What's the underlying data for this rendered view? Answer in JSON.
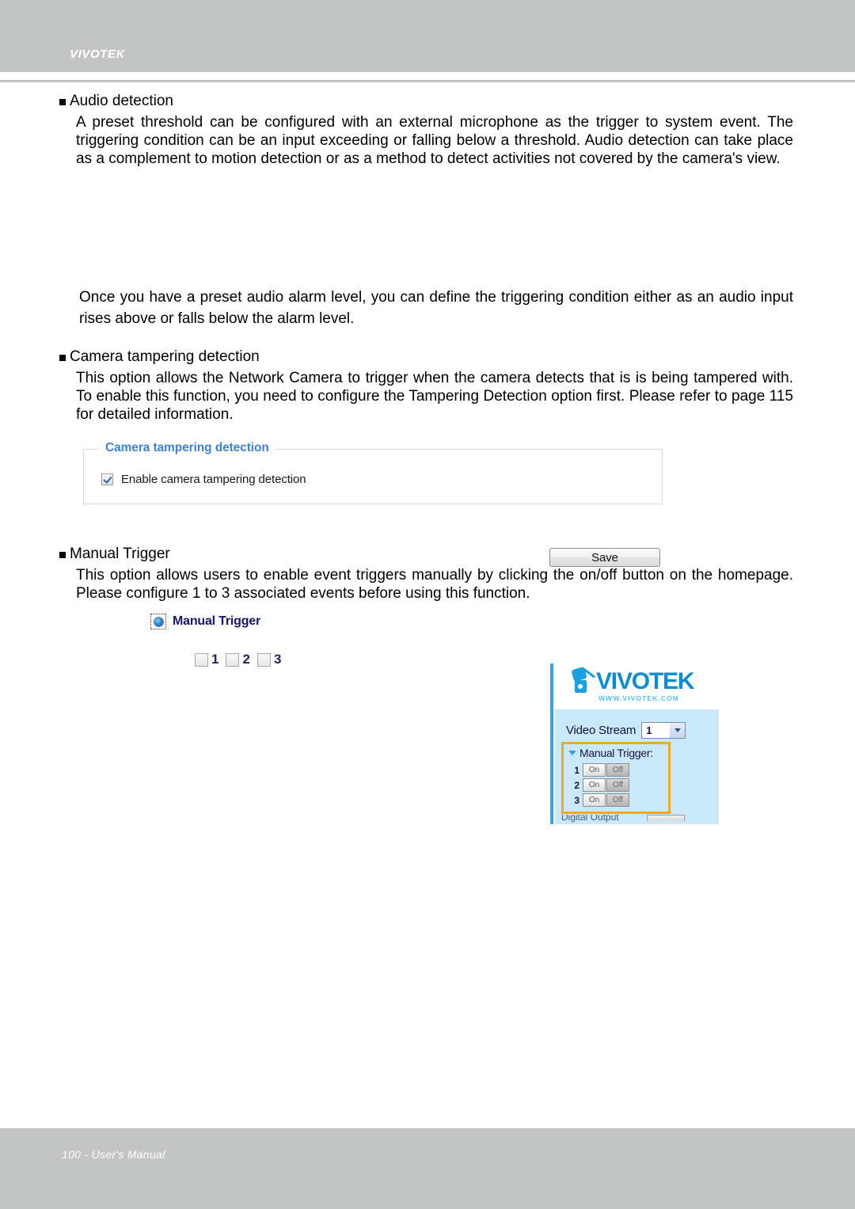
{
  "header": {
    "brand": "VIVOTEK"
  },
  "sections": {
    "audio_detection": {
      "heading": "Audio detection",
      "body": "A preset threshold can be configured with an external microphone as the trigger to system event. The triggering condition can be an input exceeding or falling below a threshold. Audio detection can take place as a complement to motion detection or as a method to detect activities not covered by the camera's view.",
      "note": "Once you have a preset audio alarm level, you can define the triggering condition either as an audio input rises above or falls below the alarm level."
    },
    "camera_tampering": {
      "heading": "Camera tampering detection",
      "body": "This option allows the Network Camera to trigger when the camera detects that is is being tampered with. To enable this function, you need to configure the Tampering Detection option first. Please refer to page 115 for detailed information."
    },
    "manual_trigger": {
      "heading": "Manual Trigger",
      "body": "This option allows users to enable event triggers manually by clicking the on/off button on the homepage. Please configure 1 to 3 associated events before using this function."
    }
  },
  "tampering_widget": {
    "legend": "Camera tampering detection",
    "enable_checkbox_label": "Enable camera tampering detection",
    "enable_checkbox_checked": true,
    "save_label": "Save",
    "legend_color": "#3c82d6"
  },
  "manual_trigger_widget": {
    "radio_label": "Manual Trigger",
    "radio_selected": true,
    "checkboxes": [
      {
        "label": "1",
        "checked": false
      },
      {
        "label": "2",
        "checked": false
      },
      {
        "label": "3",
        "checked": false
      }
    ]
  },
  "embedded_screenshot": {
    "logo_text": "VIVOTEK",
    "logo_url": "WWW.VIVOTEK.COM",
    "video_stream_label": "Video Stream",
    "video_stream_value": "1",
    "manual_trigger_title": "Manual Trigger:",
    "highlight_color": "#f5a623",
    "panel_color": "#c9e9fa",
    "rows": [
      {
        "num": "1",
        "on": "On",
        "off": "Off"
      },
      {
        "num": "2",
        "on": "On",
        "off": "Off"
      },
      {
        "num": "3",
        "on": "On",
        "off": "Off"
      }
    ],
    "cut_off_text": "Digital Output"
  },
  "footer": {
    "text": "100 - User's Manual"
  }
}
